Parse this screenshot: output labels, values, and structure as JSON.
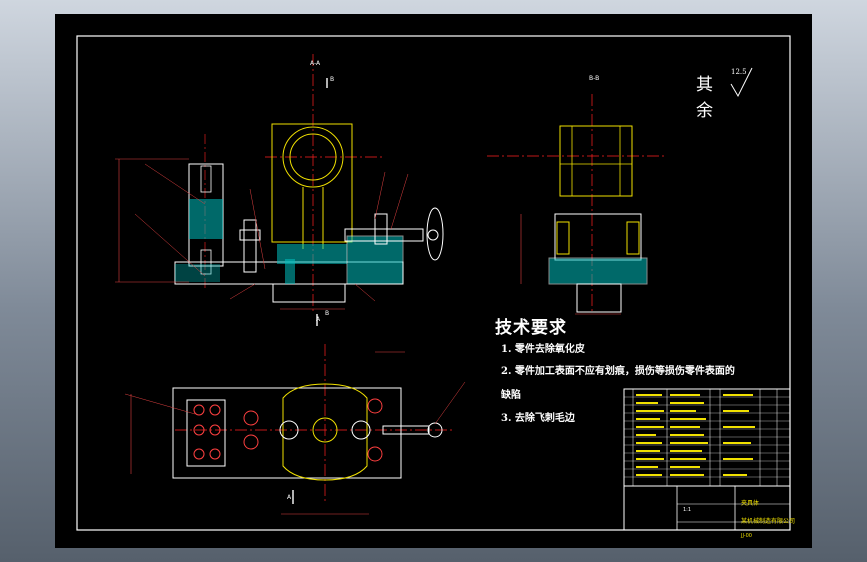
{
  "sheet": {
    "background": "#000000",
    "line_color": "#ffffff",
    "part_color": "#f0e000",
    "cut_color": "#ff2020",
    "hatch_color": "#00c0c0",
    "dim_color": "#e04040"
  },
  "views": {
    "section_aa_label": "A-A",
    "section_bb_label": "B-B",
    "cut_a_top": "A",
    "cut_a_bottom": "A",
    "cut_b_top": "B",
    "cut_b_bottom": "B"
  },
  "surface": {
    "rest_label": "其余",
    "roughness_value": "12.5"
  },
  "technical_requirements": {
    "title": "技术要求",
    "items": [
      "1. 零件去除氧化皮",
      "2. 零件加工表面不应有划痕，损伤等损伤零件表面的",
      "缺陷",
      "3. 去除飞刺毛边"
    ]
  },
  "title_block": {
    "name_cell": "夹具体",
    "company_cell": "某机械制造有限公司",
    "drawing_no": "JJ-00",
    "scale_cell": "1:1"
  },
  "icons": [
    "roughness-symbol-icon",
    "section-arrow-icon"
  ]
}
